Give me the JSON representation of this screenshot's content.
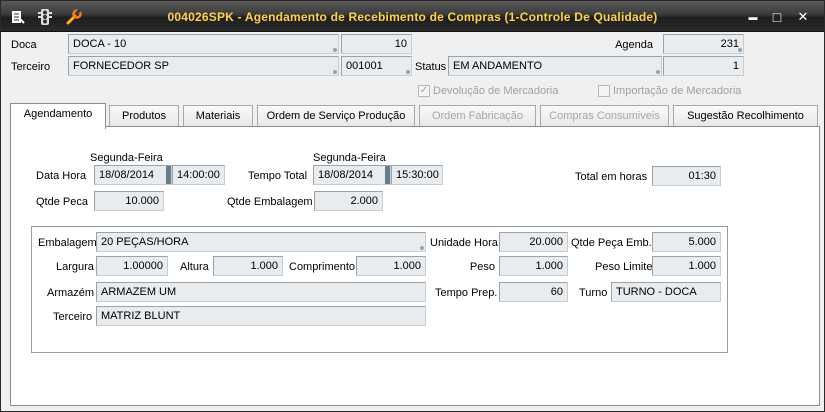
{
  "window": {
    "title": "004026SPK - Agendamento de Recebimento de Compras (1-Controle De Qualidade)",
    "controls": {
      "minimize": "▬",
      "maximize": "□",
      "close": "✕"
    }
  },
  "header": {
    "doca_label": "Doca",
    "doca_value": "DOCA - 10",
    "doca_code": "10",
    "terceiro_label": "Terceiro",
    "terceiro_value": "FORNECEDOR SP",
    "terceiro_code": "001001",
    "status_label": "Status",
    "status_value": "EM ANDAMENTO",
    "status_code": "1",
    "agenda_label": "Agenda",
    "agenda_value": "231",
    "devolucao_label": "Devolução de Mercadoria",
    "devolucao_checked": "✓",
    "importacao_label": "Importação de Mercadoria"
  },
  "tabs": [
    {
      "label": "Agendamento"
    },
    {
      "label": "Produtos"
    },
    {
      "label": "Materiais"
    },
    {
      "label": "Ordem de Serviço Produção"
    },
    {
      "label": "Ordem Fabricação"
    },
    {
      "label": "Compras Consumiveis"
    },
    {
      "label": "Sugestão Recolhimento"
    }
  ],
  "agendamento": {
    "data_hora_label": "Data Hora",
    "data_hora_day": "Segunda-Feira",
    "data_hora_date": "18/08/2014",
    "data_hora_time": "14:00:00",
    "tempo_total_label": "Tempo Total",
    "tempo_total_day": "Segunda-Feira",
    "tempo_total_date": "18/08/2014",
    "tempo_total_time": "15:30:00",
    "total_horas_label": "Total em horas",
    "total_horas_value": "01:30",
    "qtde_peca_label": "Qtde Peca",
    "qtde_peca_value": "10.000",
    "qtde_embalagem_label": "Qtde Embalagem",
    "qtde_embalagem_value": "2.000"
  },
  "embalagem_group": {
    "embalagem_label": "Embalagem",
    "embalagem_value": "20 PEÇAS/HORA",
    "unidade_hora_label": "Unidade Hora",
    "unidade_hora_value": "20.000",
    "qtde_peca_emb_label": "Qtde Peça Emb.",
    "qtde_peca_emb_value": "5.000",
    "largura_label": "Largura",
    "largura_value": "1.00000",
    "altura_label": "Altura",
    "altura_value": "1.000",
    "comprimento_label": "Comprimento",
    "comprimento_value": "1.000",
    "peso_label": "Peso",
    "peso_value": "1.000",
    "peso_limite_label": "Peso Limite",
    "peso_limite_value": "1.000",
    "armazem_label": "Armazém",
    "armazem_value": "ARMAZEM UM",
    "tempo_prep_label": "Tempo Prep.",
    "tempo_prep_value": "60",
    "turno_label": "Turno",
    "turno_value": "TURNO - DOCA",
    "terceiro_label": "Terceiro",
    "terceiro_value": "MATRIZ BLUNT"
  }
}
